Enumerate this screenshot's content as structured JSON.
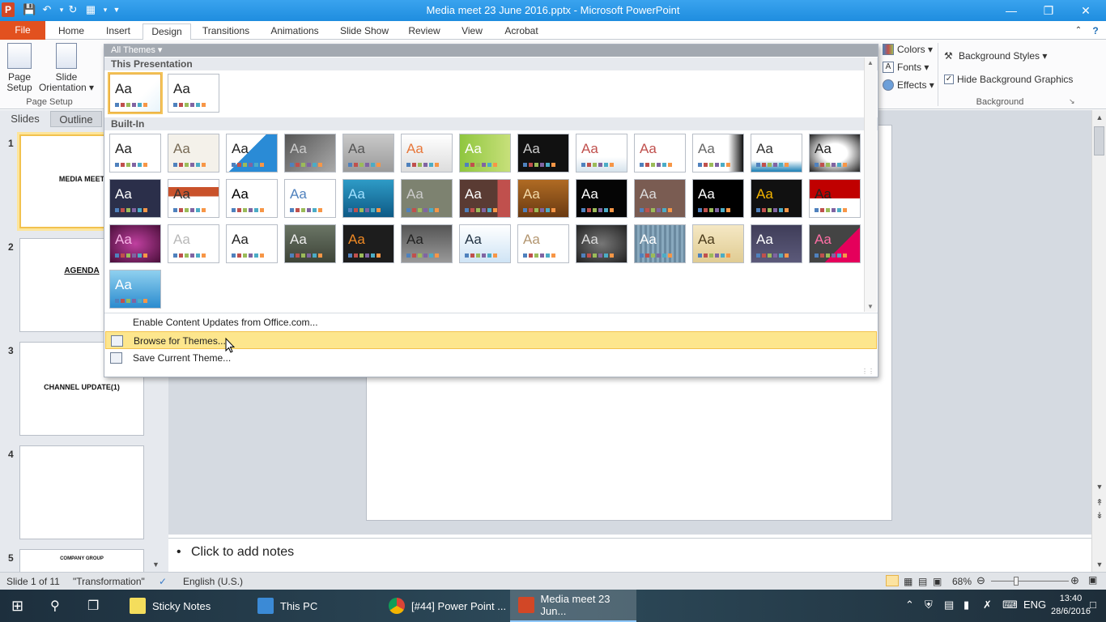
{
  "window": {
    "title": "Media meet  23 June 2016.pptx - Microsoft PowerPoint",
    "app_logo": "P"
  },
  "tabs": [
    {
      "label": "File"
    },
    {
      "label": "Home"
    },
    {
      "label": "Insert"
    },
    {
      "label": "Design"
    },
    {
      "label": "Transitions"
    },
    {
      "label": "Animations"
    },
    {
      "label": "Slide Show"
    },
    {
      "label": "Review"
    },
    {
      "label": "View"
    },
    {
      "label": "Acrobat"
    }
  ],
  "ribbon": {
    "page_setup_line1": "Page",
    "page_setup_line2": "Setup",
    "slide_orientation_line1": "Slide",
    "slide_orientation_line2": "Orientation ▾",
    "group_page_setup": "Page Setup",
    "colors": "Colors ▾",
    "fonts": "Fonts ▾",
    "effects": "Effects ▾",
    "background_styles": "Background Styles ▾",
    "hide_background": "Hide Background Graphics",
    "group_background": "Background"
  },
  "gallery": {
    "filter_label": "All Themes ▾",
    "section_this": "This Presentation",
    "section_builtin": "Built-In",
    "aa": "Aa",
    "menu": {
      "enable_updates": "Enable Content Updates from Office.com...",
      "browse": "Browse for Themes...",
      "save": "Save Current Theme..."
    }
  },
  "left_pane": {
    "tab_slides": "Slides",
    "tab_outline": "Outline",
    "slides": [
      {
        "num": "1",
        "title": "MEDIA MEET"
      },
      {
        "num": "2",
        "title": "AGENDA"
      },
      {
        "num": "3",
        "title": "CHANNEL UPDATE(1)"
      },
      {
        "num": "4",
        "title": ""
      },
      {
        "num": "5",
        "title": "COMPANY GROUP"
      }
    ]
  },
  "notes": {
    "placeholder": "Click to add notes"
  },
  "statusbar": {
    "slide_info": "Slide 1 of 11",
    "theme_name": "\"Transformation\"",
    "language": "English (U.S.)",
    "zoom": "68%"
  },
  "taskbar": {
    "items": [
      {
        "label": "Sticky Notes"
      },
      {
        "label": "This PC"
      },
      {
        "label": "[#44] Power Point ..."
      },
      {
        "label": "Media meet  23 Jun..."
      }
    ],
    "lang": "ENG",
    "time": "13:40",
    "date": "28/6/2016"
  }
}
